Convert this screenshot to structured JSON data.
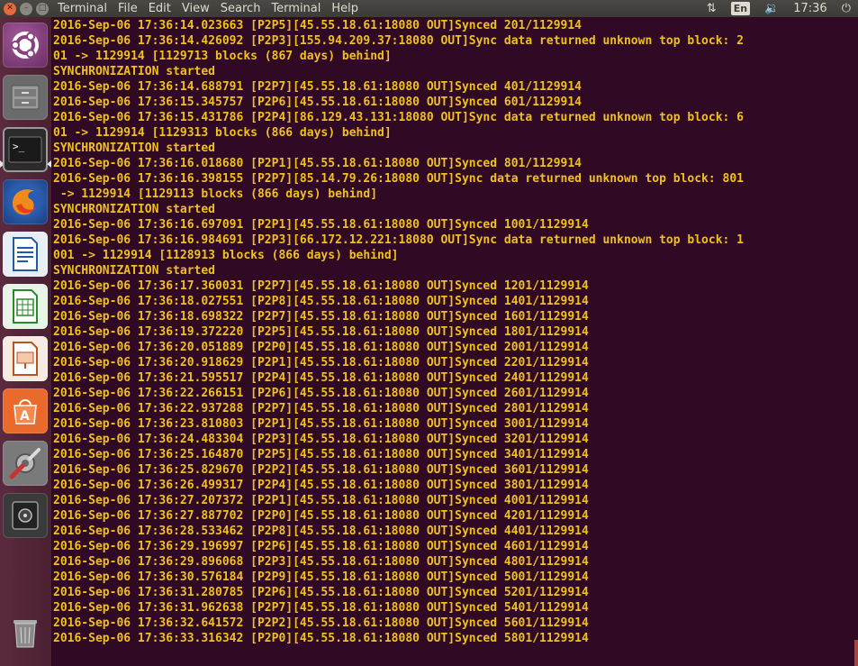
{
  "topbar": {
    "menu": [
      "Terminal",
      "File",
      "Edit",
      "View",
      "Search",
      "Terminal",
      "Help"
    ],
    "lang": "En",
    "time": "17:36"
  },
  "launcher": {
    "items": [
      "ubuntu-dash-icon",
      "files-icon",
      "terminal-icon",
      "firefox-icon",
      "writer-icon",
      "calc-icon",
      "impress-icon",
      "software-center-icon",
      "settings-icon",
      "safe-icon"
    ],
    "trash": "trash-icon"
  },
  "terminal": {
    "lines": [
      "2016-Sep-06 17:36:14.023663 [P2P5][45.55.18.61:18080 OUT]Synced 201/1129914",
      "2016-Sep-06 17:36:14.426092 [P2P3][155.94.209.37:18080 OUT]Sync data returned unknown top block: 2",
      "01 -> 1129914 [1129713 blocks (867 days) behind]",
      "SYNCHRONIZATION started",
      "2016-Sep-06 17:36:14.688791 [P2P7][45.55.18.61:18080 OUT]Synced 401/1129914",
      "2016-Sep-06 17:36:15.345757 [P2P6][45.55.18.61:18080 OUT]Synced 601/1129914",
      "2016-Sep-06 17:36:15.431786 [P2P4][86.129.43.131:18080 OUT]Sync data returned unknown top block: 6",
      "01 -> 1129914 [1129313 blocks (866 days) behind]",
      "SYNCHRONIZATION started",
      "2016-Sep-06 17:36:16.018680 [P2P1][45.55.18.61:18080 OUT]Synced 801/1129914",
      "2016-Sep-06 17:36:16.398155 [P2P7][85.14.79.26:18080 OUT]Sync data returned unknown top block: 801",
      " -> 1129914 [1129113 blocks (866 days) behind]",
      "SYNCHRONIZATION started",
      "2016-Sep-06 17:36:16.697091 [P2P1][45.55.18.61:18080 OUT]Synced 1001/1129914",
      "2016-Sep-06 17:36:16.984691 [P2P3][66.172.12.221:18080 OUT]Sync data returned unknown top block: 1",
      "001 -> 1129914 [1128913 blocks (866 days) behind]",
      "SYNCHRONIZATION started",
      "2016-Sep-06 17:36:17.360031 [P2P7][45.55.18.61:18080 OUT]Synced 1201/1129914",
      "2016-Sep-06 17:36:18.027551 [P2P8][45.55.18.61:18080 OUT]Synced 1401/1129914",
      "2016-Sep-06 17:36:18.698322 [P2P7][45.55.18.61:18080 OUT]Synced 1601/1129914",
      "2016-Sep-06 17:36:19.372220 [P2P5][45.55.18.61:18080 OUT]Synced 1801/1129914",
      "2016-Sep-06 17:36:20.051889 [P2P0][45.55.18.61:18080 OUT]Synced 2001/1129914",
      "2016-Sep-06 17:36:20.918629 [P2P1][45.55.18.61:18080 OUT]Synced 2201/1129914",
      "2016-Sep-06 17:36:21.595517 [P2P4][45.55.18.61:18080 OUT]Synced 2401/1129914",
      "2016-Sep-06 17:36:22.266151 [P2P6][45.55.18.61:18080 OUT]Synced 2601/1129914",
      "2016-Sep-06 17:36:22.937288 [P2P7][45.55.18.61:18080 OUT]Synced 2801/1129914",
      "2016-Sep-06 17:36:23.810803 [P2P1][45.55.18.61:18080 OUT]Synced 3001/1129914",
      "2016-Sep-06 17:36:24.483304 [P2P3][45.55.18.61:18080 OUT]Synced 3201/1129914",
      "2016-Sep-06 17:36:25.164870 [P2P5][45.55.18.61:18080 OUT]Synced 3401/1129914",
      "2016-Sep-06 17:36:25.829670 [P2P2][45.55.18.61:18080 OUT]Synced 3601/1129914",
      "2016-Sep-06 17:36:26.499317 [P2P4][45.55.18.61:18080 OUT]Synced 3801/1129914",
      "2016-Sep-06 17:36:27.207372 [P2P1][45.55.18.61:18080 OUT]Synced 4001/1129914",
      "2016-Sep-06 17:36:27.887702 [P2P0][45.55.18.61:18080 OUT]Synced 4201/1129914",
      "2016-Sep-06 17:36:28.533462 [P2P8][45.55.18.61:18080 OUT]Synced 4401/1129914",
      "2016-Sep-06 17:36:29.196997 [P2P6][45.55.18.61:18080 OUT]Synced 4601/1129914",
      "2016-Sep-06 17:36:29.896068 [P2P3][45.55.18.61:18080 OUT]Synced 4801/1129914",
      "2016-Sep-06 17:36:30.576184 [P2P9][45.55.18.61:18080 OUT]Synced 5001/1129914",
      "2016-Sep-06 17:36:31.280785 [P2P6][45.55.18.61:18080 OUT]Synced 5201/1129914",
      "2016-Sep-06 17:36:31.962638 [P2P7][45.55.18.61:18080 OUT]Synced 5401/1129914",
      "2016-Sep-06 17:36:32.641572 [P2P2][45.55.18.61:18080 OUT]Synced 5601/1129914",
      "2016-Sep-06 17:36:33.316342 [P2P0][45.55.18.61:18080 OUT]Synced 5801/1129914"
    ]
  }
}
